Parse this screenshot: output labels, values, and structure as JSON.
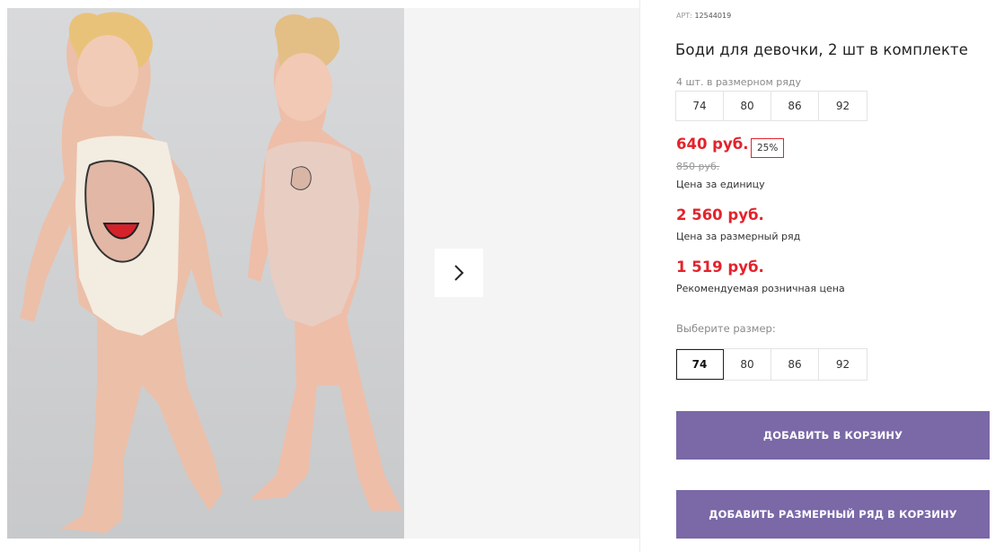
{
  "product": {
    "article_label": "АРТ:",
    "article_value": "12544019",
    "title": "Боди для девочки, 2 шт в комплекте"
  },
  "size_range": {
    "label": "4 шт. в размерном ряду",
    "sizes": [
      "74",
      "80",
      "86",
      "92"
    ]
  },
  "pricing": {
    "unit_price": "640 руб.",
    "discount_badge": "25%",
    "old_price": "850 руб.",
    "unit_price_label": "Цена за единицу",
    "range_price": "2 560 руб.",
    "range_price_label": "Цена за размерный ряд",
    "retail_price": "1 519 руб.",
    "retail_price_label": "Рекомендуемая розничная цена"
  },
  "size_picker": {
    "label": "Выберите размер:",
    "sizes": [
      "74",
      "80",
      "86",
      "92"
    ],
    "selected": "74"
  },
  "actions": {
    "add_to_cart": "ДОБАВИТЬ В КОРЗИНУ",
    "add_range_to_cart": "ДОБАВИТЬ РАЗМЕРНЫЙ РЯД В КОРЗИНУ"
  },
  "gallery": {
    "next_icon": "chevron-right-icon"
  },
  "colors": {
    "price_red": "#e3232c",
    "button_purple": "#7a68a7"
  }
}
